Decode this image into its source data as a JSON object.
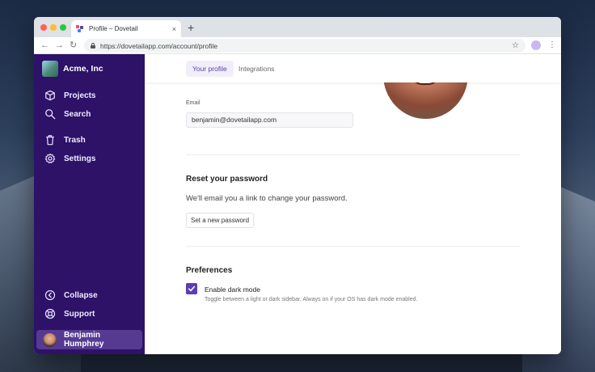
{
  "browser": {
    "tab_title": "Profile – Dovetail",
    "tab_close": "×",
    "new_tab": "+",
    "url": "https://dovetailapp.com/account/profile",
    "back": "←",
    "forward": "→",
    "reload": "↻",
    "bookmark": "☆",
    "menu": "⋮"
  },
  "sidebar": {
    "workspace": "Acme, Inc",
    "items": [
      {
        "label": "Projects",
        "icon": "cube-icon"
      },
      {
        "label": "Search",
        "icon": "search-icon"
      },
      {
        "label": "Trash",
        "icon": "trash-icon"
      },
      {
        "label": "Settings",
        "icon": "gear-icon"
      }
    ],
    "collapse": {
      "label": "Collapse",
      "icon": "collapse-icon"
    },
    "support": {
      "label": "Support",
      "icon": "lifebuoy-icon"
    },
    "user": {
      "name": "Benjamin Humphrey"
    }
  },
  "main": {
    "tabs": [
      {
        "label": "Your profile",
        "active": true
      },
      {
        "label": "Integrations",
        "active": false
      }
    ],
    "email": {
      "label": "Email",
      "value": "benjamin@dovetailapp.com"
    },
    "password": {
      "title": "Reset your password",
      "description": "We'll email you a link to change your password.",
      "button": "Set a new password"
    },
    "preferences": {
      "title": "Preferences",
      "dark_mode_label": "Enable dark mode",
      "dark_mode_checked": true,
      "dark_mode_hint": "Toggle between a light or dark sidebar. Always on if your OS has dark mode enabled."
    }
  },
  "colors": {
    "sidebar_bg": "#2d1268",
    "accent": "#5b3fb0",
    "user_row_bg": "#563a92"
  }
}
